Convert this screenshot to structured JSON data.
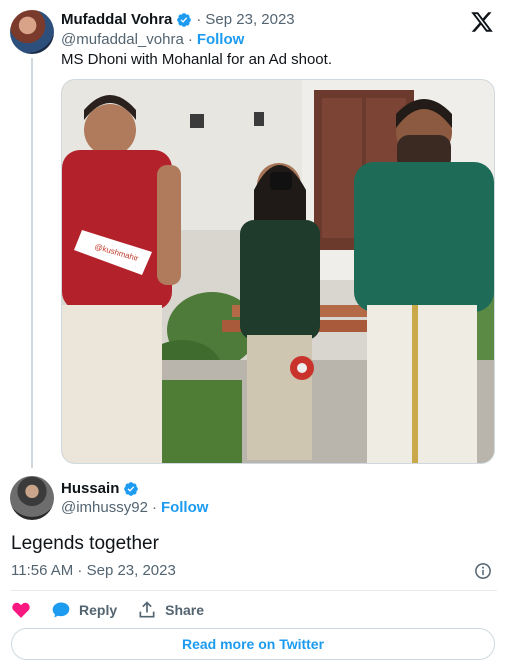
{
  "parent_tweet": {
    "author_name": "Mufaddal Vohra",
    "separator": "·",
    "date": "Sep 23, 2023",
    "handle": "@mufaddal_vohra",
    "follow_label": "Follow",
    "text": "MS Dhoni with Mohanlal for an Ad shoot.",
    "photo_overlay_text": "@kushmahir",
    "avatar_icon": "user-avatar",
    "verified_icon": "verified-badge-icon"
  },
  "reply_tweet": {
    "author_name": "Hussain",
    "separator": "·",
    "handle": "@imhussy92",
    "follow_label": "Follow",
    "text": "Legends together",
    "timestamp": "11:56 AM · Sep 23, 2023"
  },
  "actions": {
    "like_icon": "heart-icon",
    "reply_label": "Reply",
    "share_label": "Share"
  },
  "read_more_label": "Read more on Twitter",
  "colors": {
    "accent": "#1d9bf0",
    "like": "#f91880",
    "text_primary": "#0f1419",
    "text_secondary": "#536471"
  }
}
